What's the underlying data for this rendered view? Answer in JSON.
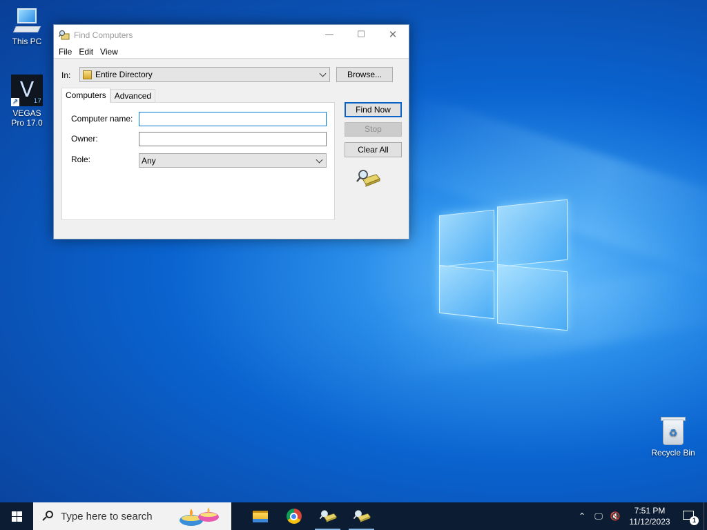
{
  "desktop": {
    "icons": [
      {
        "label": "This PC",
        "icon": "this-pc-icon"
      },
      {
        "label": "VEGAS Pro 17.0",
        "icon": "vegas-pro-icon"
      },
      {
        "label": "Recycle Bin",
        "icon": "recycle-bin-icon"
      }
    ],
    "vegas_logo_letter": "V",
    "vegas_badge": "17"
  },
  "dialog": {
    "title": "Find Computers",
    "menu": [
      "File",
      "Edit",
      "View"
    ],
    "in_label": "In:",
    "in_value": "Entire Directory",
    "browse_label": "Browse...",
    "tabs": [
      {
        "label": "Computers",
        "active": true
      },
      {
        "label": "Advanced",
        "active": false
      }
    ],
    "fields": {
      "computer_name_label": "Computer name:",
      "computer_name_value": "",
      "owner_label": "Owner:",
      "owner_value": "",
      "role_label": "Role:",
      "role_value": "Any"
    },
    "buttons": {
      "find_now": "Find Now",
      "stop": "Stop",
      "clear_all": "Clear All"
    }
  },
  "taskbar": {
    "search_placeholder": "Type here to search",
    "apps": [
      {
        "name": "file-explorer",
        "icon": "folder-icon"
      },
      {
        "name": "chrome",
        "icon": "chrome-icon"
      },
      {
        "name": "find-computers-1",
        "icon": "find-computers-icon"
      },
      {
        "name": "find-computers-2",
        "icon": "find-computers-icon"
      }
    ],
    "time": "7:51 PM",
    "date": "11/12/2023",
    "notification_count": "1"
  },
  "colors": {
    "accent": "#0078d7",
    "taskbar_bg": "#0c1d33",
    "desktop_blue": "#0a63cf"
  }
}
